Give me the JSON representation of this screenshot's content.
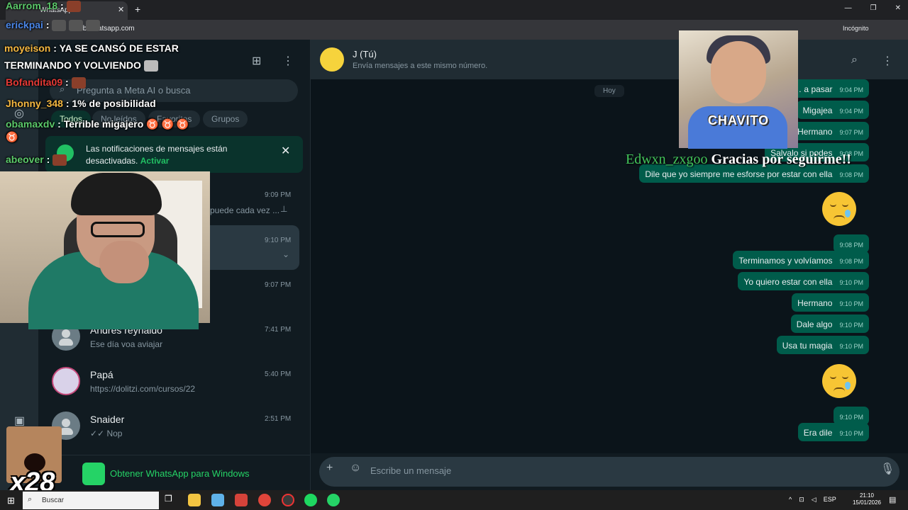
{
  "browser": {
    "tab_title": "WhatsApp",
    "tab_close": "✕",
    "new_tab": "+",
    "url": "web.whatsapp.com",
    "incognito": "Incógnito",
    "window_controls": [
      "—",
      "❐",
      "✕"
    ]
  },
  "sidebar": {
    "search_placeholder": "Pregunta a Meta AI o busca",
    "filters": [
      "Todos",
      "No leídos",
      "Favoritos",
      "Grupos"
    ],
    "notification": {
      "text": "Las notificaciones de mensajes están desactivadas.",
      "action": "Activar"
    },
    "chats": [
      {
        "name": "",
        "preview": "puede cada vez ...",
        "time": "9:09 PM",
        "pinned": true
      },
      {
        "name": "",
        "preview": "",
        "time": "9:10 PM",
        "selected": true
      },
      {
        "name": "",
        "preview": "",
        "time": "9:07 PM"
      },
      {
        "name": "Andrés reynaldo",
        "preview": "Ese día voa aviajar",
        "time": "7:41 PM"
      },
      {
        "name": "Papá",
        "preview": "https://dolitzi.com/cursos/22",
        "time": "5:40 PM"
      },
      {
        "name": "Snaider",
        "preview": "✓✓ Nop",
        "time": "2:51 PM"
      }
    ],
    "get_app": "Obtener WhatsApp para Windows"
  },
  "chat": {
    "name": "J (Tú)",
    "subtitle": "Envía mensajes a este mismo número.",
    "day_label": "Hoy",
    "messages": [
      {
        "text": "Bo… a pasar",
        "time": "9:04 PM"
      },
      {
        "text": "Migajea",
        "time": "9:04 PM"
      },
      {
        "text": "Hermano",
        "time": "9:07 PM"
      },
      {
        "text": "Salvalo si podes",
        "time": "9:08 PM"
      },
      {
        "text": "Dile que yo siempre me esforse por estar con ella",
        "time": "9:08 PM"
      },
      {
        "emoji": "crying-face",
        "time": "9:08 PM"
      },
      {
        "text": "Terminamos y volvíamos",
        "time": "9:08 PM"
      },
      {
        "text": "Yo quiero estar con ella",
        "time": "9:10 PM"
      },
      {
        "text": "Hermano",
        "time": "9:10 PM"
      },
      {
        "text": "Dale algo",
        "time": "9:10 PM"
      },
      {
        "text": "Usa tu magia",
        "time": "9:10 PM"
      },
      {
        "emoji": "crying-face",
        "time": "9:10 PM"
      },
      {
        "text": "Era dile",
        "time": "9:10 PM"
      }
    ],
    "composer_placeholder": "Escribe un mensaje"
  },
  "stream": {
    "chat_lines": [
      {
        "user": "Aarrom_18",
        "color": "u-green",
        "text": ""
      },
      {
        "user": "erickpai",
        "color": "u-blue",
        "text": ""
      },
      {
        "user": "moyeison",
        "color": "u-orange",
        "text": "YA SE CANSÓ DE ESTAR TERMINANDO Y VOLVIENDO"
      },
      {
        "user": "Bofandita09",
        "color": "u-red",
        "text": ""
      },
      {
        "user": "Jhonny_348",
        "color": "u-orange",
        "text": "1% de posibilidad"
      },
      {
        "user": "obamaxdv",
        "color": "u-green",
        "text": "Terrible migajero"
      },
      {
        "user": "abeover",
        "color": "u-green",
        "text": ""
      }
    ],
    "alert_image_label": "CHAVITO",
    "follow_user": "Edwxn_zxgoo",
    "follow_message": "Gracias por seguirme!!",
    "combo": "x28"
  },
  "taskbar": {
    "search": "Buscar",
    "lang": "ESP",
    "time": "21:10",
    "date": "15/01/2026"
  },
  "colors": {
    "wa_green": "#25d366",
    "bubble_out": "#005c4b",
    "panel": "#111b21"
  }
}
